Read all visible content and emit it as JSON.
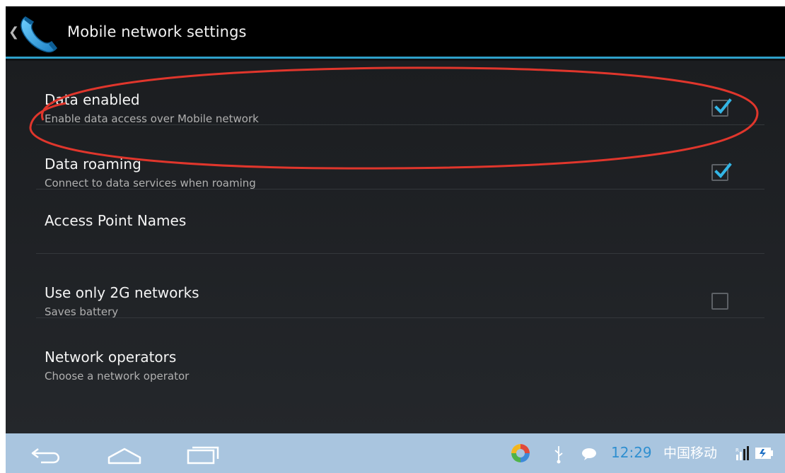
{
  "action_bar": {
    "title": "Mobile network settings",
    "up_icon": "chevron-left-icon",
    "app_icon": "phone-handset-icon",
    "accent_color": "#2ea0c9"
  },
  "preferences": [
    {
      "title": "Data enabled",
      "summary": "Enable data access over Mobile network",
      "checked": true,
      "highlighted": true
    },
    {
      "title": "Data roaming",
      "summary": "Connect to data services when roaming",
      "checked": true
    },
    {
      "title": "Access Point Names",
      "summary": ""
    },
    {
      "title": "Use only 2G networks",
      "summary": "Saves battery",
      "checked": false
    },
    {
      "title": "Network operators",
      "summary": "Choose a network operator"
    }
  ],
  "annotation": {
    "shape": "ellipse",
    "color": "#e0362c"
  },
  "nav_bar": {
    "buttons": [
      "back-icon",
      "home-icon",
      "recent-apps-icon"
    ],
    "background": "#a9c5df"
  },
  "status_bar": {
    "time": "12:29",
    "carrier": "中国移动",
    "icons": [
      "app-notification-icon",
      "usb-icon",
      "chat-icon",
      "signal-icon",
      "battery-icon"
    ],
    "time_color": "#2f8fd0"
  }
}
